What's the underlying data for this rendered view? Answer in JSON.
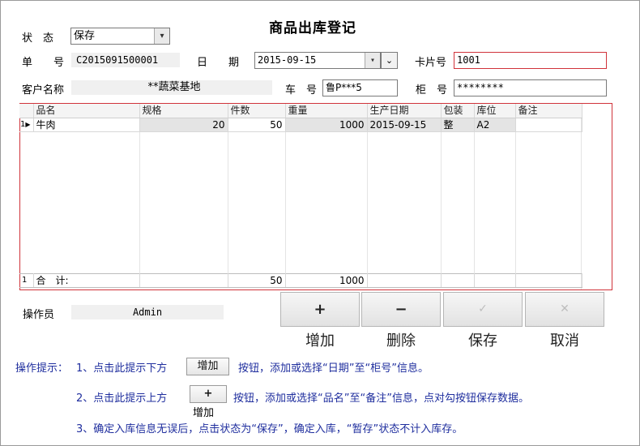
{
  "title": "商品出库登记",
  "form": {
    "status_label": "状　态",
    "status_value": "保存",
    "doc_no_label": "单　　号",
    "doc_no_value": "C2015091500001",
    "date_label": "日　　期",
    "date_value": "2015-09-15",
    "card_label": "卡片号",
    "card_value": "1001",
    "customer_label": "客户名称",
    "customer_value": "**蔬菜基地",
    "plate_label": "车　号",
    "plate_value": "鲁P***5",
    "cabinet_label": "柜　号",
    "cabinet_value": "********",
    "operator_label": "操作员",
    "operator_value": "Admin"
  },
  "grid": {
    "columns": [
      "品名",
      "规格",
      "件数",
      "重量",
      "生产日期",
      "包装",
      "库位",
      "备注"
    ],
    "rows": [
      {
        "row_no": "1",
        "name": "牛肉",
        "spec": "20",
        "count": "50",
        "weight": "1000",
        "date": "2015-09-15",
        "pack": "整",
        "location": "A2",
        "note": ""
      }
    ],
    "footer": {
      "row_no": "1",
      "label": "合　计:",
      "count": "50",
      "weight": "1000"
    }
  },
  "buttons": {
    "add_icon": "+",
    "add_label": "增加",
    "delete_icon": "−",
    "delete_label": "删除",
    "save_icon": "✓",
    "save_label": "保存",
    "cancel_icon": "✕",
    "cancel_label": "取消"
  },
  "hints": {
    "prefix": "操作提示：",
    "line1_a": "1、点击此提示下方",
    "line1_btn": "增加",
    "line1_b": "按钮，添加或选择“日期”至“柜号”信息。",
    "line2_a": "2、点击此提示上方",
    "line2_btn": "+",
    "line2_btn_caption": "增加",
    "line2_b": "按钮，添加或选择“品名”至“备注”信息，点对勾按钮保存数据。",
    "line3": "3、确定入库信息无误后，点击状态为“保存”，确定入库，“暂存”状态不计入库存。"
  },
  "colors": {
    "highlight_border": "#d0333a",
    "hint_text": "#1f2e9e"
  },
  "icons": {
    "combo_arrow": "chevron-down-icon",
    "row_pointer": "triangle-right-icon"
  }
}
